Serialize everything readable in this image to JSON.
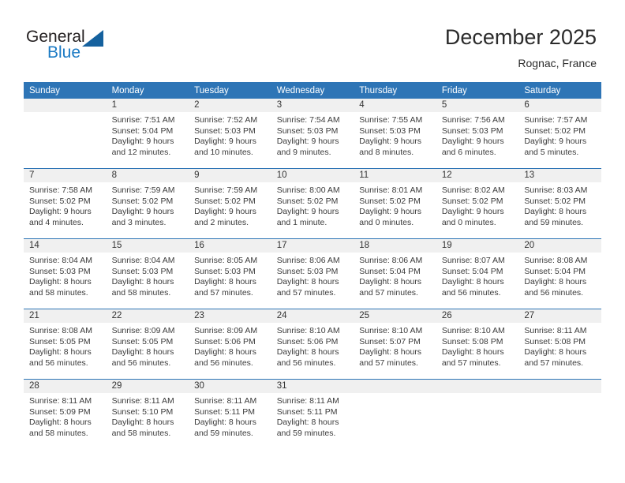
{
  "brand": {
    "name_top": "General",
    "name_bottom": "Blue",
    "accent_color": "#1b7ac4",
    "triangle_color": "#15619e"
  },
  "header": {
    "title": "December 2025",
    "subtitle": "Rognac, France"
  },
  "theme": {
    "header_row_bg": "#2e75b6",
    "daynum_band_bg": "#f0f0f0",
    "row_divider": "#2e75b6",
    "text": "#3b3b3b"
  },
  "weekdays": [
    "Sunday",
    "Monday",
    "Tuesday",
    "Wednesday",
    "Thursday",
    "Friday",
    "Saturday"
  ],
  "labels": {
    "sunrise_prefix": "Sunrise:",
    "sunset_prefix": "Sunset:",
    "daylight_prefix": "Daylight:"
  },
  "weeks": [
    [
      {
        "day": "",
        "empty": true,
        "line1": "",
        "line2": "",
        "line3": "",
        "line4": ""
      },
      {
        "day": "1",
        "line1": "Sunrise: 7:51 AM",
        "line2": "Sunset: 5:04 PM",
        "line3": "Daylight: 9 hours",
        "line4": "and 12 minutes."
      },
      {
        "day": "2",
        "line1": "Sunrise: 7:52 AM",
        "line2": "Sunset: 5:03 PM",
        "line3": "Daylight: 9 hours",
        "line4": "and 10 minutes."
      },
      {
        "day": "3",
        "line1": "Sunrise: 7:54 AM",
        "line2": "Sunset: 5:03 PM",
        "line3": "Daylight: 9 hours",
        "line4": "and 9 minutes."
      },
      {
        "day": "4",
        "line1": "Sunrise: 7:55 AM",
        "line2": "Sunset: 5:03 PM",
        "line3": "Daylight: 9 hours",
        "line4": "and 8 minutes."
      },
      {
        "day": "5",
        "line1": "Sunrise: 7:56 AM",
        "line2": "Sunset: 5:03 PM",
        "line3": "Daylight: 9 hours",
        "line4": "and 6 minutes."
      },
      {
        "day": "6",
        "line1": "Sunrise: 7:57 AM",
        "line2": "Sunset: 5:02 PM",
        "line3": "Daylight: 9 hours",
        "line4": "and 5 minutes."
      }
    ],
    [
      {
        "day": "7",
        "line1": "Sunrise: 7:58 AM",
        "line2": "Sunset: 5:02 PM",
        "line3": "Daylight: 9 hours",
        "line4": "and 4 minutes."
      },
      {
        "day": "8",
        "line1": "Sunrise: 7:59 AM",
        "line2": "Sunset: 5:02 PM",
        "line3": "Daylight: 9 hours",
        "line4": "and 3 minutes."
      },
      {
        "day": "9",
        "line1": "Sunrise: 7:59 AM",
        "line2": "Sunset: 5:02 PM",
        "line3": "Daylight: 9 hours",
        "line4": "and 2 minutes."
      },
      {
        "day": "10",
        "line1": "Sunrise: 8:00 AM",
        "line2": "Sunset: 5:02 PM",
        "line3": "Daylight: 9 hours",
        "line4": "and 1 minute."
      },
      {
        "day": "11",
        "line1": "Sunrise: 8:01 AM",
        "line2": "Sunset: 5:02 PM",
        "line3": "Daylight: 9 hours",
        "line4": "and 0 minutes."
      },
      {
        "day": "12",
        "line1": "Sunrise: 8:02 AM",
        "line2": "Sunset: 5:02 PM",
        "line3": "Daylight: 9 hours",
        "line4": "and 0 minutes."
      },
      {
        "day": "13",
        "line1": "Sunrise: 8:03 AM",
        "line2": "Sunset: 5:02 PM",
        "line3": "Daylight: 8 hours",
        "line4": "and 59 minutes."
      }
    ],
    [
      {
        "day": "14",
        "line1": "Sunrise: 8:04 AM",
        "line2": "Sunset: 5:03 PM",
        "line3": "Daylight: 8 hours",
        "line4": "and 58 minutes."
      },
      {
        "day": "15",
        "line1": "Sunrise: 8:04 AM",
        "line2": "Sunset: 5:03 PM",
        "line3": "Daylight: 8 hours",
        "line4": "and 58 minutes."
      },
      {
        "day": "16",
        "line1": "Sunrise: 8:05 AM",
        "line2": "Sunset: 5:03 PM",
        "line3": "Daylight: 8 hours",
        "line4": "and 57 minutes."
      },
      {
        "day": "17",
        "line1": "Sunrise: 8:06 AM",
        "line2": "Sunset: 5:03 PM",
        "line3": "Daylight: 8 hours",
        "line4": "and 57 minutes."
      },
      {
        "day": "18",
        "line1": "Sunrise: 8:06 AM",
        "line2": "Sunset: 5:04 PM",
        "line3": "Daylight: 8 hours",
        "line4": "and 57 minutes."
      },
      {
        "day": "19",
        "line1": "Sunrise: 8:07 AM",
        "line2": "Sunset: 5:04 PM",
        "line3": "Daylight: 8 hours",
        "line4": "and 56 minutes."
      },
      {
        "day": "20",
        "line1": "Sunrise: 8:08 AM",
        "line2": "Sunset: 5:04 PM",
        "line3": "Daylight: 8 hours",
        "line4": "and 56 minutes."
      }
    ],
    [
      {
        "day": "21",
        "line1": "Sunrise: 8:08 AM",
        "line2": "Sunset: 5:05 PM",
        "line3": "Daylight: 8 hours",
        "line4": "and 56 minutes."
      },
      {
        "day": "22",
        "line1": "Sunrise: 8:09 AM",
        "line2": "Sunset: 5:05 PM",
        "line3": "Daylight: 8 hours",
        "line4": "and 56 minutes."
      },
      {
        "day": "23",
        "line1": "Sunrise: 8:09 AM",
        "line2": "Sunset: 5:06 PM",
        "line3": "Daylight: 8 hours",
        "line4": "and 56 minutes."
      },
      {
        "day": "24",
        "line1": "Sunrise: 8:10 AM",
        "line2": "Sunset: 5:06 PM",
        "line3": "Daylight: 8 hours",
        "line4": "and 56 minutes."
      },
      {
        "day": "25",
        "line1": "Sunrise: 8:10 AM",
        "line2": "Sunset: 5:07 PM",
        "line3": "Daylight: 8 hours",
        "line4": "and 57 minutes."
      },
      {
        "day": "26",
        "line1": "Sunrise: 8:10 AM",
        "line2": "Sunset: 5:08 PM",
        "line3": "Daylight: 8 hours",
        "line4": "and 57 minutes."
      },
      {
        "day": "27",
        "line1": "Sunrise: 8:11 AM",
        "line2": "Sunset: 5:08 PM",
        "line3": "Daylight: 8 hours",
        "line4": "and 57 minutes."
      }
    ],
    [
      {
        "day": "28",
        "line1": "Sunrise: 8:11 AM",
        "line2": "Sunset: 5:09 PM",
        "line3": "Daylight: 8 hours",
        "line4": "and 58 minutes."
      },
      {
        "day": "29",
        "line1": "Sunrise: 8:11 AM",
        "line2": "Sunset: 5:10 PM",
        "line3": "Daylight: 8 hours",
        "line4": "and 58 minutes."
      },
      {
        "day": "30",
        "line1": "Sunrise: 8:11 AM",
        "line2": "Sunset: 5:11 PM",
        "line3": "Daylight: 8 hours",
        "line4": "and 59 minutes."
      },
      {
        "day": "31",
        "line1": "Sunrise: 8:11 AM",
        "line2": "Sunset: 5:11 PM",
        "line3": "Daylight: 8 hours",
        "line4": "and 59 minutes."
      },
      {
        "day": "",
        "empty": true,
        "line1": "",
        "line2": "",
        "line3": "",
        "line4": ""
      },
      {
        "day": "",
        "empty": true,
        "line1": "",
        "line2": "",
        "line3": "",
        "line4": ""
      },
      {
        "day": "",
        "empty": true,
        "line1": "",
        "line2": "",
        "line3": "",
        "line4": ""
      }
    ]
  ]
}
